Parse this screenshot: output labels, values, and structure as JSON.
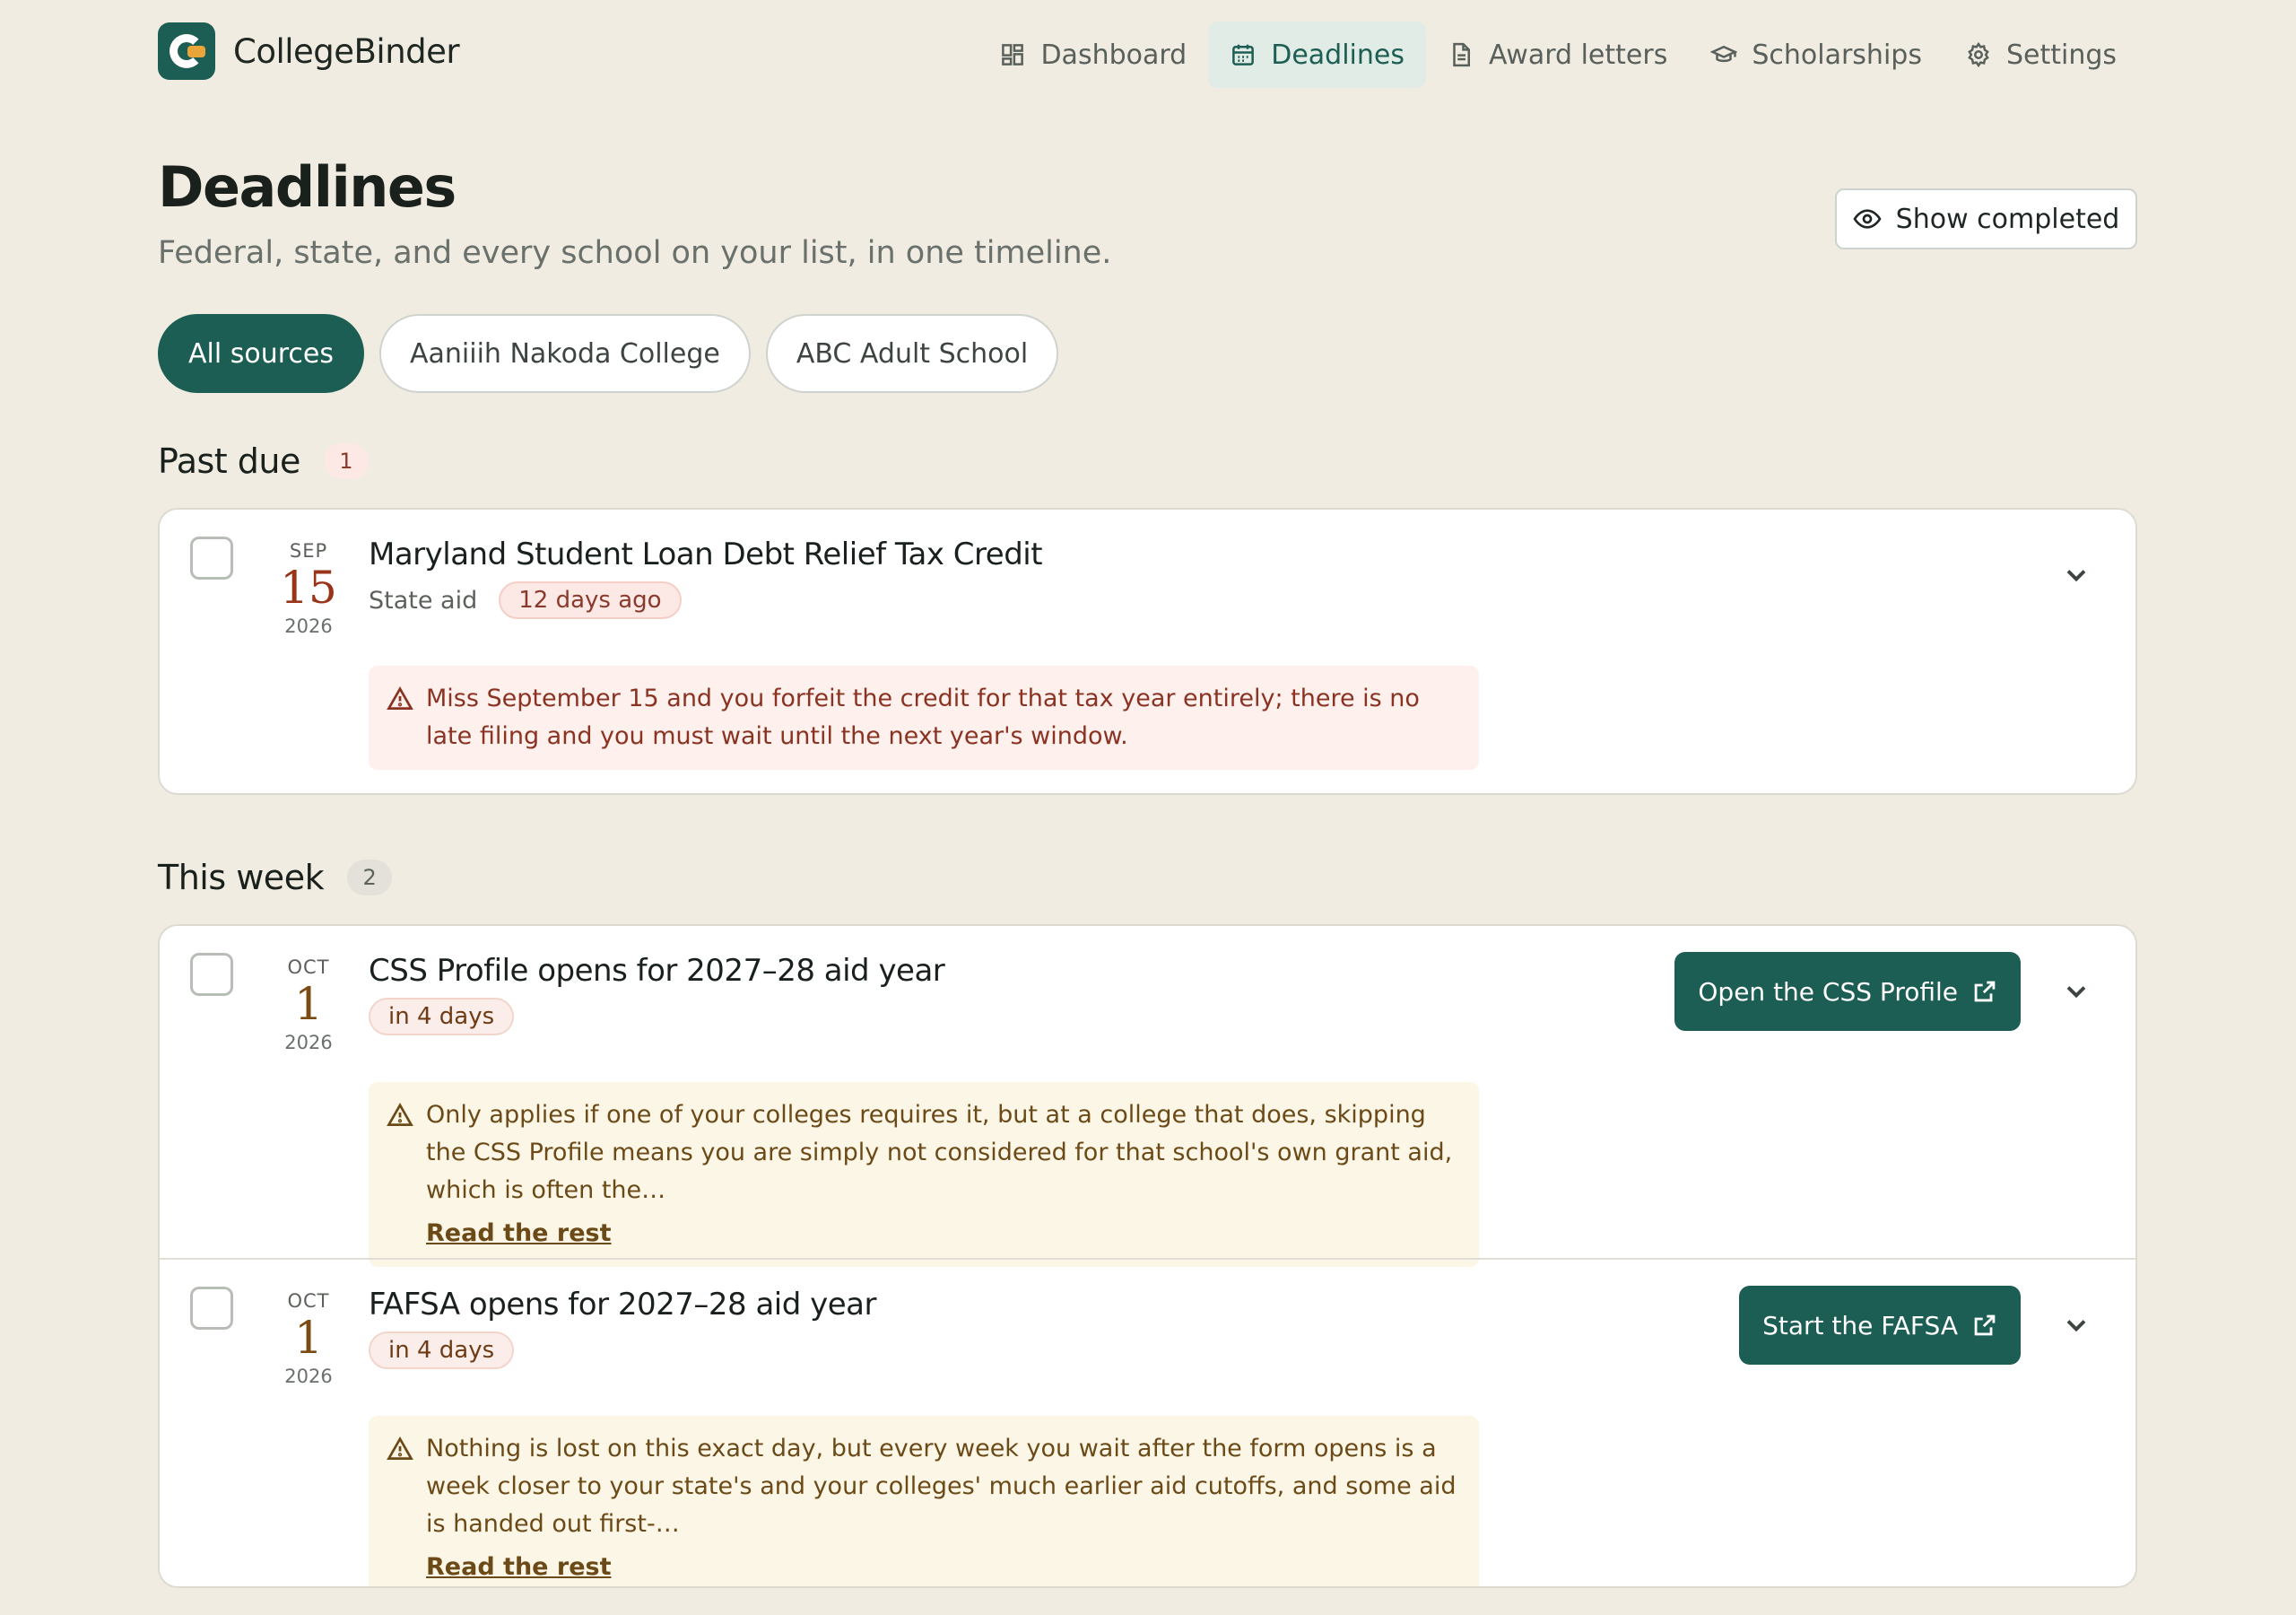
{
  "brand": {
    "name": "CollegeBinder"
  },
  "nav": {
    "dashboard": "Dashboard",
    "deadlines": "Deadlines",
    "award_letters": "Award letters",
    "scholarships": "Scholarships",
    "settings": "Settings"
  },
  "header": {
    "title": "Deadlines",
    "subtitle": "Federal, state, and every school on your list, in one timeline.",
    "show_completed": "Show completed"
  },
  "filters": [
    "All sources",
    "Aaniiih Nakoda College",
    "ABC Adult School"
  ],
  "sections": {
    "past_due": {
      "title": "Past due",
      "count": "1",
      "items": [
        {
          "month": "SEP",
          "day": "15",
          "year": "2026",
          "title": "Maryland Student Loan Debt Relief Tax Credit",
          "kind": "State aid",
          "due": "12 days ago",
          "notice": "Miss September 15 and you forfeit the credit for that tax year entirely; there is no late filing and you must wait until the next year's window."
        }
      ]
    },
    "this_week": {
      "title": "This week",
      "count": "2",
      "items": [
        {
          "month": "OCT",
          "day": "1",
          "year": "2026",
          "title": "CSS Profile opens for 2027–28 aid year",
          "due": "in 4 days",
          "action": "Open the CSS Profile",
          "notice": "Only applies if one of your colleges requires it, but at a college that does, skipping the CSS Profile means you are simply not considered for that school's own grant aid, which is often the…",
          "more": "Read the rest"
        },
        {
          "month": "OCT",
          "day": "1",
          "year": "2026",
          "title": "FAFSA opens for 2027–28 aid year",
          "due": "in 4 days",
          "action": "Start the FAFSA",
          "notice": "Nothing is lost on this exact day, but every week you wait after the form opens is a week closer to your state's and your colleges' much earlier aid cutoffs, and some aid is handed out first-…",
          "more": "Read the rest"
        }
      ]
    }
  },
  "colors": {
    "background": "#f0ece1",
    "primary": "#1c5e53",
    "logo_accent": "#e9a53a",
    "overdue": "#9a3418"
  },
  "icons": {
    "dashboard": "grid-icon",
    "deadlines": "calendar-icon",
    "award_letters": "document-icon",
    "scholarships": "graduation-cap-icon",
    "settings": "gear-icon",
    "show_completed": "eye-icon",
    "notice": "warning-triangle-icon",
    "action": "external-link-icon",
    "expand": "chevron-down-icon"
  }
}
